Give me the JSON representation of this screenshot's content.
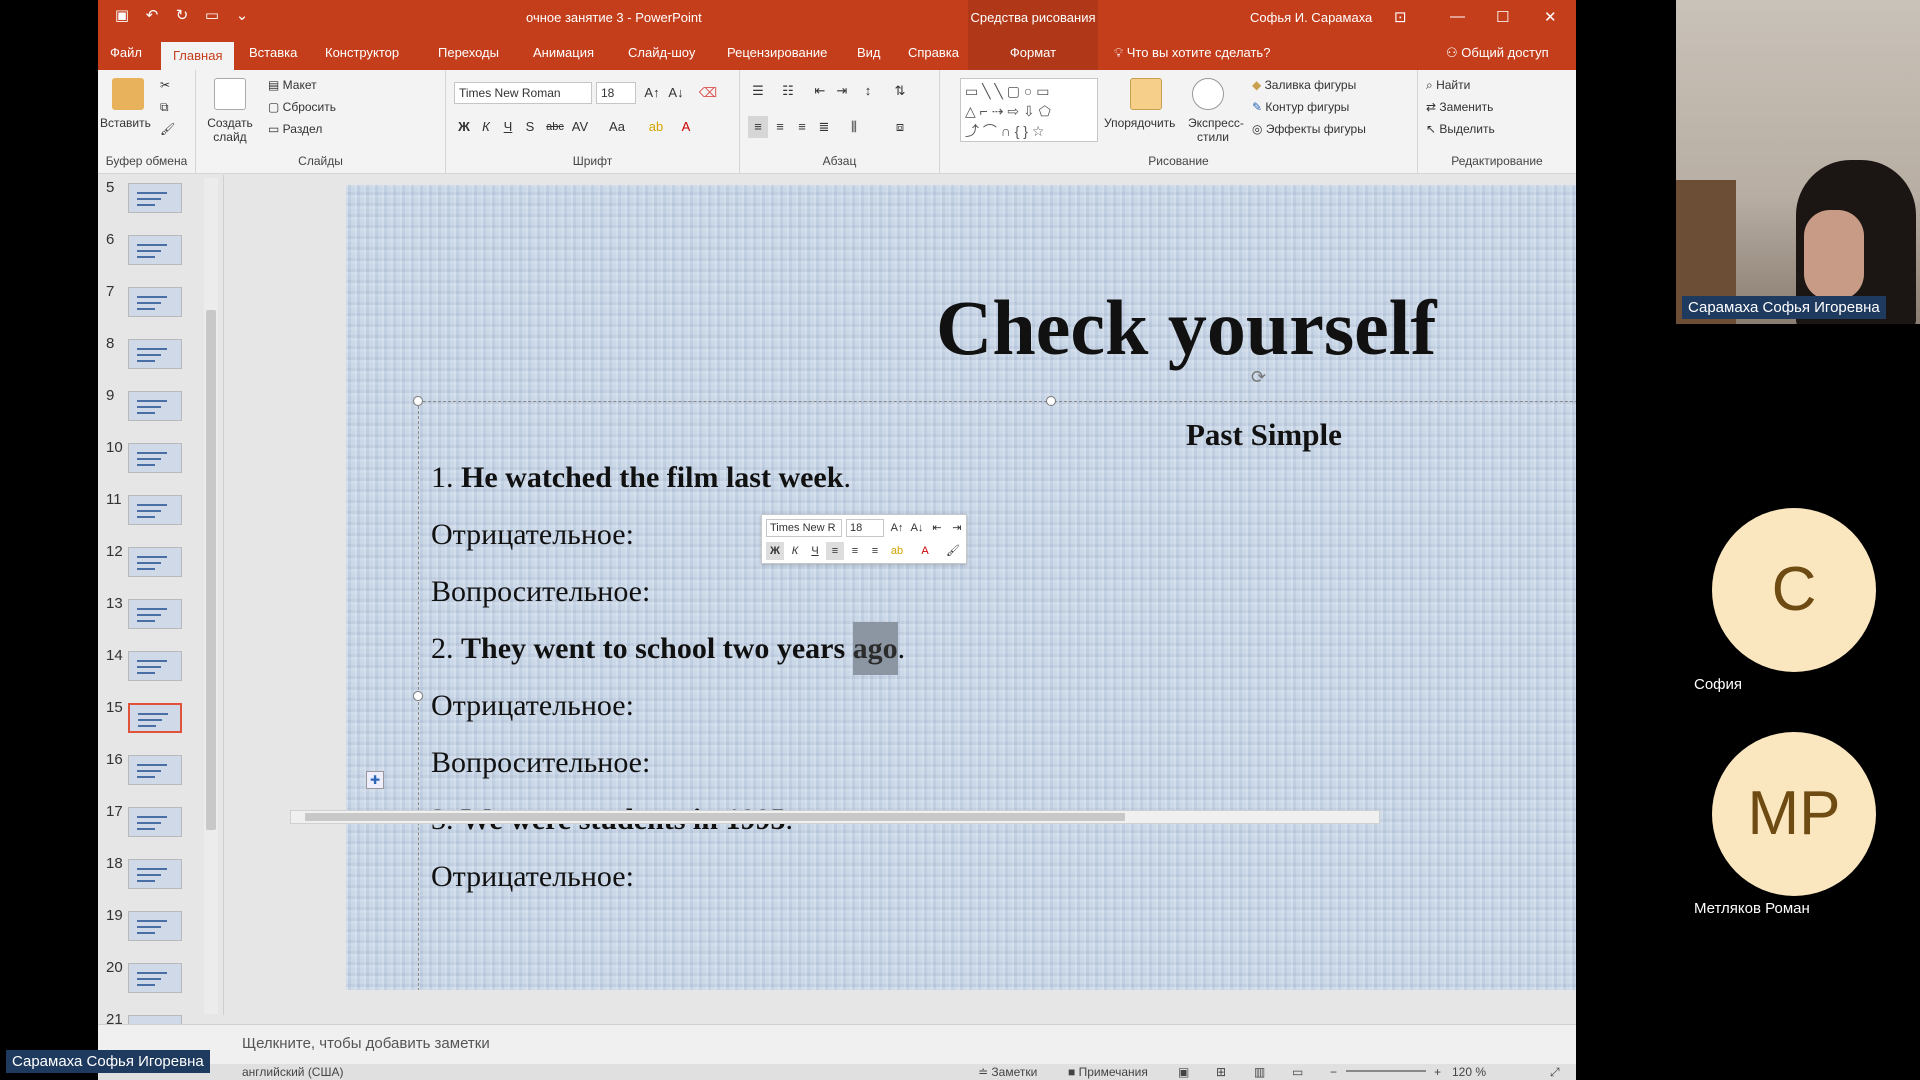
{
  "titlebar": {
    "doc_title": "очное занятие 3  -  PowerPoint",
    "drawing_tools": "Средства рисования",
    "user": "Софья И. Сарамаха"
  },
  "tabs": [
    "Файл",
    "Главная",
    "Вставка",
    "Конструктор",
    "Переходы",
    "Анимация",
    "Слайд-шоу",
    "Рецензирование",
    "Вид",
    "Справка"
  ],
  "format_tab": "Формат",
  "tell_me": "Что вы хотите сделать?",
  "share": "Общий доступ",
  "ribbon": {
    "clipboard": {
      "paste": "Вставить",
      "label": "Буфер обмена"
    },
    "slides": {
      "new_slide": "Создать слайд",
      "layout": "Макет",
      "reset": "Сбросить",
      "section": "Раздел",
      "label": "Слайды"
    },
    "font": {
      "family": "Times New Roman",
      "size": "18",
      "label": "Шрифт",
      "bold": "Ж",
      "italic": "К",
      "underline": "Ч",
      "shadow": "S",
      "strike": "abc",
      "case": "Aa"
    },
    "paragraph": {
      "label": "Абзац"
    },
    "drawing": {
      "arrange": "Упорядочить",
      "quick_styles": "Экспресс-стили",
      "fill": "Заливка фигуры",
      "outline": "Контур фигуры",
      "effects": "Эффекты фигуры",
      "label": "Рисование"
    },
    "editing": {
      "find": "Найти",
      "replace": "Заменить",
      "select": "Выделить",
      "label": "Редактирование"
    }
  },
  "thumbnails": [
    {
      "num": "5"
    },
    {
      "num": "6"
    },
    {
      "num": "7"
    },
    {
      "num": "8"
    },
    {
      "num": "9"
    },
    {
      "num": "10"
    },
    {
      "num": "11"
    },
    {
      "num": "12"
    },
    {
      "num": "13"
    },
    {
      "num": "14"
    },
    {
      "num": "15"
    },
    {
      "num": "16"
    },
    {
      "num": "17"
    },
    {
      "num": "18"
    },
    {
      "num": "19"
    },
    {
      "num": "20"
    },
    {
      "num": "21"
    }
  ],
  "active_slide": "15",
  "slide": {
    "title": "Check yourself",
    "subtitle": "Past Simple",
    "items": [
      {
        "num": "1. ",
        "text": "He watched the film last week",
        "end": "."
      },
      {
        "label": "Отрицательное:"
      },
      {
        "label": "Вопросительное:"
      },
      {
        "num": "2. ",
        "text": "They went to school two years ",
        "highlight": "ago",
        "end": "."
      },
      {
        "label": "Отрицательное:"
      },
      {
        "label": "Вопросительное:"
      },
      {
        "num": "3. ",
        "text": "We were students in 1995",
        "end": "."
      },
      {
        "label": "Отрицательное:"
      }
    ]
  },
  "mini_toolbar": {
    "font": "Times New R",
    "size": "18"
  },
  "notes_placeholder": "Щелкните, чтобы добавить заметки",
  "status": {
    "language": "английский (США)",
    "notes": "Заметки",
    "comments": "Примечания",
    "zoom": "120 %"
  },
  "video": {
    "presenter": "Сарамаха Софья Игоревна",
    "participants": [
      {
        "initials": "С",
        "name": "София"
      },
      {
        "initials": "МР",
        "name": "Метляков Роман"
      }
    ],
    "self_label": "Сарамаха Софья Игоревна"
  }
}
